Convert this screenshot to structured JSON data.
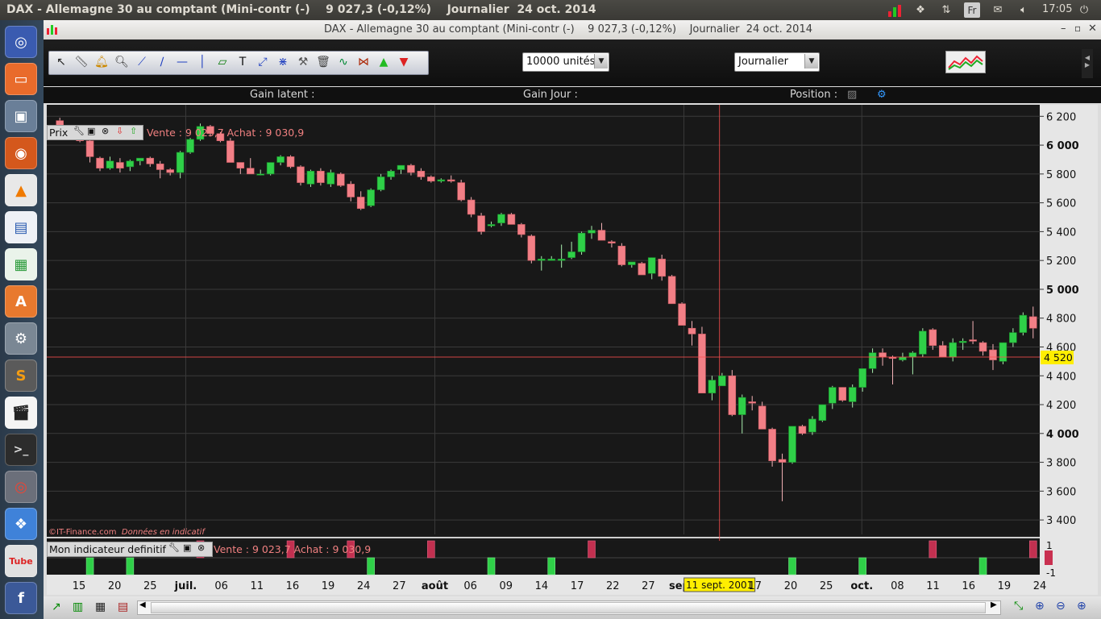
{
  "os": {
    "window_title": "DAX - Allemagne 30 au comptant (Mini-contr (-)    9 027,3 (-0,12%)    Journalier  24 oct. 2014",
    "clock": "17:05",
    "keyboard": "Fr",
    "launcher_icons": [
      "ubuntu-icon",
      "files-icon",
      "screenshot-icon",
      "firefox-icon",
      "vlc-icon",
      "document-icon",
      "spreadsheet-icon",
      "software-center-icon",
      "settings-icon",
      "sublime-icon",
      "clapper-icon",
      "terminal-icon",
      "disc-icon",
      "dropbox-icon",
      "youtube-icon",
      "facebook-icon"
    ]
  },
  "app": {
    "title": "DAX - Allemagne 30 au comptant (Mini-contr (-)    9 027,3 (-0,12%)    Journalier  24 oct. 2014",
    "quantity": "10000 unités",
    "period": "Journalier",
    "info": {
      "gain_latent": "Gain latent :",
      "gain_jour": "Gain Jour :",
      "position": "Position :"
    },
    "price_panel_label": "Prix",
    "price_quote": "Vente : 9 023,7 Achat : 9 030,9",
    "indicator_label": "Mon indicateur definitif",
    "indicator_quote": "Vente : 9 023,7 Achat : 9 030,9",
    "watermark_brand": "©IT-Finance.com",
    "watermark_note": "Données en indicatif",
    "crosshair_price": "4 520",
    "crosshair_date": "11 sept. 2001",
    "colors": {
      "up": "#2fd048",
      "down": "#f27f86",
      "crosshair": "#ff5050",
      "highlight": "#ffee00"
    }
  },
  "chart_data": {
    "type": "candlestick",
    "ylim": [
      3300,
      6280
    ],
    "y_ticks": [
      "6 200",
      "6 000",
      "5 800",
      "5 600",
      "5 400",
      "5 200",
      "5 000",
      "4 800",
      "4 600",
      "4 400",
      "4 200",
      "4 000",
      "3 800",
      "3 600",
      "3 400"
    ],
    "y_tick_values": [
      6200,
      6000,
      5800,
      5600,
      5400,
      5200,
      5000,
      4800,
      4600,
      4400,
      4200,
      4000,
      3800,
      3600,
      3400
    ],
    "bold_ticks": [
      "6 000",
      "5 000",
      "4 000"
    ],
    "x_labels": [
      "15",
      "20",
      "25",
      "juil.",
      "06",
      "11",
      "16",
      "19",
      "24",
      "27",
      "août",
      "06",
      "09",
      "14",
      "17",
      "22",
      "27",
      "sept.",
      "11 sept. 2001",
      "17",
      "20",
      "25",
      "oct.",
      "08",
      "11",
      "16",
      "19",
      "24"
    ],
    "bold_x_labels": [
      "juil.",
      "août",
      "sept.",
      "oct."
    ],
    "candles": [
      [
        6170,
        6190,
        6040,
        6070
      ],
      [
        6070,
        6110,
        6040,
        6100
      ],
      [
        6100,
        6110,
        6020,
        6030
      ],
      [
        6030,
        6040,
        5880,
        5920
      ],
      [
        5910,
        5920,
        5820,
        5840
      ],
      [
        5840,
        5920,
        5830,
        5890
      ],
      [
        5880,
        5910,
        5810,
        5840
      ],
      [
        5850,
        5900,
        5820,
        5890
      ],
      [
        5890,
        5910,
        5860,
        5910
      ],
      [
        5910,
        5920,
        5850,
        5870
      ],
      [
        5870,
        5890,
        5770,
        5830
      ],
      [
        5830,
        5840,
        5790,
        5810
      ],
      [
        5810,
        5960,
        5770,
        5950
      ],
      [
        5950,
        6050,
        5940,
        6040
      ],
      [
        6040,
        6150,
        6030,
        6130
      ],
      [
        6130,
        6140,
        6060,
        6080
      ],
      [
        6080,
        6090,
        6020,
        6030
      ],
      [
        6030,
        6050,
        5910,
        5880
      ],
      [
        5880,
        5880,
        5800,
        5840
      ],
      [
        5840,
        5910,
        5810,
        5800
      ],
      [
        5800,
        5830,
        5790,
        5800
      ],
      [
        5800,
        5880,
        5790,
        5880
      ],
      [
        5880,
        5930,
        5860,
        5920
      ],
      [
        5920,
        5930,
        5840,
        5850
      ],
      [
        5850,
        5860,
        5720,
        5740
      ],
      [
        5730,
        5830,
        5710,
        5820
      ],
      [
        5820,
        5840,
        5720,
        5740
      ],
      [
        5730,
        5830,
        5710,
        5810
      ],
      [
        5800,
        5810,
        5710,
        5720
      ],
      [
        5730,
        5750,
        5610,
        5640
      ],
      [
        5640,
        5680,
        5550,
        5560
      ],
      [
        5580,
        5700,
        5570,
        5690
      ],
      [
        5690,
        5800,
        5680,
        5780
      ],
      [
        5780,
        5830,
        5760,
        5820
      ],
      [
        5830,
        5860,
        5800,
        5860
      ],
      [
        5860,
        5870,
        5790,
        5810
      ],
      [
        5820,
        5840,
        5760,
        5780
      ],
      [
        5780,
        5790,
        5740,
        5750
      ],
      [
        5750,
        5770,
        5740,
        5760
      ],
      [
        5760,
        5790,
        5740,
        5750
      ],
      [
        5740,
        5760,
        5610,
        5620
      ],
      [
        5620,
        5640,
        5500,
        5520
      ],
      [
        5510,
        5530,
        5380,
        5400
      ],
      [
        5440,
        5470,
        5430,
        5450
      ],
      [
        5460,
        5530,
        5440,
        5520
      ],
      [
        5520,
        5530,
        5460,
        5450
      ],
      [
        5450,
        5460,
        5360,
        5380
      ],
      [
        5370,
        5380,
        5180,
        5200
      ],
      [
        5200,
        5230,
        5130,
        5210
      ],
      [
        5200,
        5230,
        5200,
        5210
      ],
      [
        5200,
        5310,
        5150,
        5210
      ],
      [
        5220,
        5330,
        5210,
        5260
      ],
      [
        5260,
        5400,
        5240,
        5390
      ],
      [
        5390,
        5440,
        5350,
        5410
      ],
      [
        5410,
        5460,
        5350,
        5340
      ],
      [
        5330,
        5340,
        5290,
        5320
      ],
      [
        5300,
        5320,
        5160,
        5170
      ],
      [
        5170,
        5180,
        5150,
        5190
      ],
      [
        5180,
        5190,
        5100,
        5100
      ],
      [
        5110,
        5220,
        5070,
        5220
      ],
      [
        5210,
        5240,
        5060,
        5090
      ],
      [
        5090,
        5100,
        4900,
        4900
      ],
      [
        4900,
        4910,
        4760,
        4750
      ],
      [
        4730,
        4780,
        4610,
        4690
      ],
      [
        4690,
        4740,
        4330,
        4280
      ],
      [
        4280,
        4400,
        4230,
        4370
      ],
      [
        4330,
        4420,
        4330,
        4400
      ],
      [
        4400,
        4440,
        4120,
        4130
      ],
      [
        4130,
        4270,
        4000,
        4250
      ],
      [
        4220,
        4260,
        4160,
        4210
      ],
      [
        4190,
        4220,
        4090,
        4030
      ],
      [
        4030,
        4040,
        3770,
        3810
      ],
      [
        3820,
        3860,
        3530,
        3800
      ],
      [
        3800,
        4050,
        3790,
        4050
      ],
      [
        4050,
        4060,
        3990,
        4000
      ],
      [
        4010,
        4120,
        3990,
        4100
      ],
      [
        4090,
        4200,
        4080,
        4200
      ],
      [
        4210,
        4330,
        4170,
        4320
      ],
      [
        4320,
        4320,
        4220,
        4230
      ],
      [
        4220,
        4340,
        4180,
        4320
      ],
      [
        4320,
        4440,
        4290,
        4450
      ],
      [
        4450,
        4590,
        4420,
        4560
      ],
      [
        4560,
        4590,
        4470,
        4530
      ],
      [
        4530,
        4540,
        4340,
        4520
      ],
      [
        4510,
        4560,
        4500,
        4530
      ],
      [
        4530,
        4570,
        4410,
        4560
      ],
      [
        4550,
        4730,
        4530,
        4710
      ],
      [
        4720,
        4730,
        4580,
        4610
      ],
      [
        4610,
        4640,
        4560,
        4530
      ],
      [
        4530,
        4660,
        4500,
        4630
      ],
      [
        4630,
        4660,
        4580,
        4640
      ],
      [
        4650,
        4780,
        4620,
        4640
      ],
      [
        4630,
        4640,
        4540,
        4570
      ],
      [
        4580,
        4620,
        4440,
        4510
      ],
      [
        4500,
        4630,
        4480,
        4630
      ],
      [
        4630,
        4730,
        4600,
        4700
      ],
      [
        4700,
        4840,
        4680,
        4820
      ],
      [
        4810,
        4880,
        4660,
        4730
      ]
    ],
    "indicator_ylim": [
      -1,
      1
    ],
    "indicator_ticks": [
      "1",
      "-1"
    ],
    "indicator_signals": [
      [
        3,
        -1
      ],
      [
        7,
        -1
      ],
      [
        14,
        1
      ],
      [
        23,
        1
      ],
      [
        29,
        1
      ],
      [
        31,
        -1
      ],
      [
        37,
        1
      ],
      [
        43,
        -1
      ],
      [
        49,
        -1
      ],
      [
        53,
        1
      ],
      [
        73,
        -1
      ],
      [
        80,
        -1
      ],
      [
        87,
        1
      ],
      [
        92,
        -1
      ],
      [
        97,
        1
      ]
    ]
  }
}
